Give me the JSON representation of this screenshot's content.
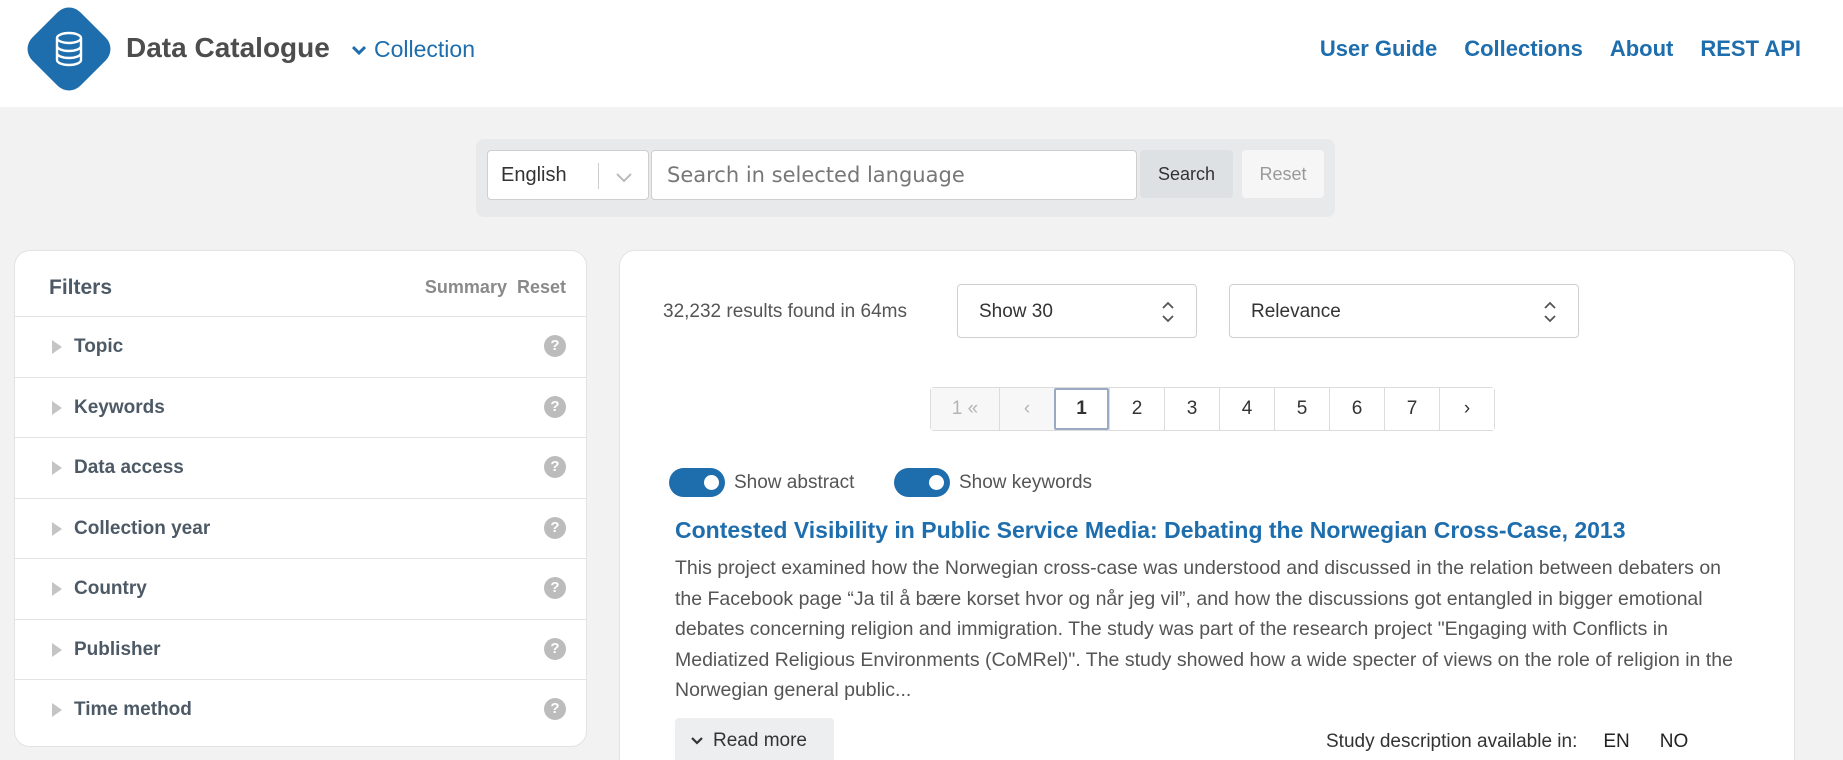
{
  "header": {
    "brand": "Data Catalogue",
    "collection_label": "Collection",
    "nav": [
      "User Guide",
      "Collections",
      "About",
      "REST API"
    ]
  },
  "search": {
    "language": "English",
    "placeholder": "Search in selected language",
    "search_label": "Search",
    "reset_label": "Reset"
  },
  "filters": {
    "title": "Filters",
    "summary_label": "Summary",
    "reset_label": "Reset",
    "items": [
      "Topic",
      "Keywords",
      "Data access",
      "Collection year",
      "Country",
      "Publisher",
      "Time method"
    ]
  },
  "results": {
    "count_text": "32,232 results found in 64ms",
    "show_select": "Show 30",
    "sort_select": "Relevance",
    "pagination": {
      "first": "1 «",
      "prev": "‹",
      "pages": [
        "1",
        "2",
        "3",
        "4",
        "5",
        "6",
        "7"
      ],
      "next": "›",
      "current": 1
    },
    "toggles": {
      "abstract_label": "Show abstract",
      "keywords_label": "Show keywords"
    },
    "study": {
      "title": "Contested Visibility in Public Service Media: Debating the Norwegian Cross-Case, 2013",
      "abstract": "This project examined how the Norwegian cross-case was understood and discussed in the relation between debaters on the Facebook page “Ja til å bære korset hvor og når jeg vil”, and how the discussions got entangled in bigger emotional debates concerning religion and immigration. The study was part of the research project \"Engaging with Conflicts in Mediatized Religious Environments (CoMRel)\". The study showed how a wide specter of views on the role of religion in the Norwegian general public...",
      "read_more": "Read more",
      "available_label": "Study description available in:",
      "languages": [
        "EN",
        "NO"
      ]
    }
  },
  "colors": {
    "accent": "#1e6dad",
    "background": "#f2f2f2"
  },
  "icons": {
    "logo": "database-icon",
    "collection": "chevron-down-icon",
    "language_select": "chevron-down-icon",
    "select": "updown-icon",
    "filter_expand": "triangle-right-icon",
    "filter_help": "question-circle-icon"
  }
}
